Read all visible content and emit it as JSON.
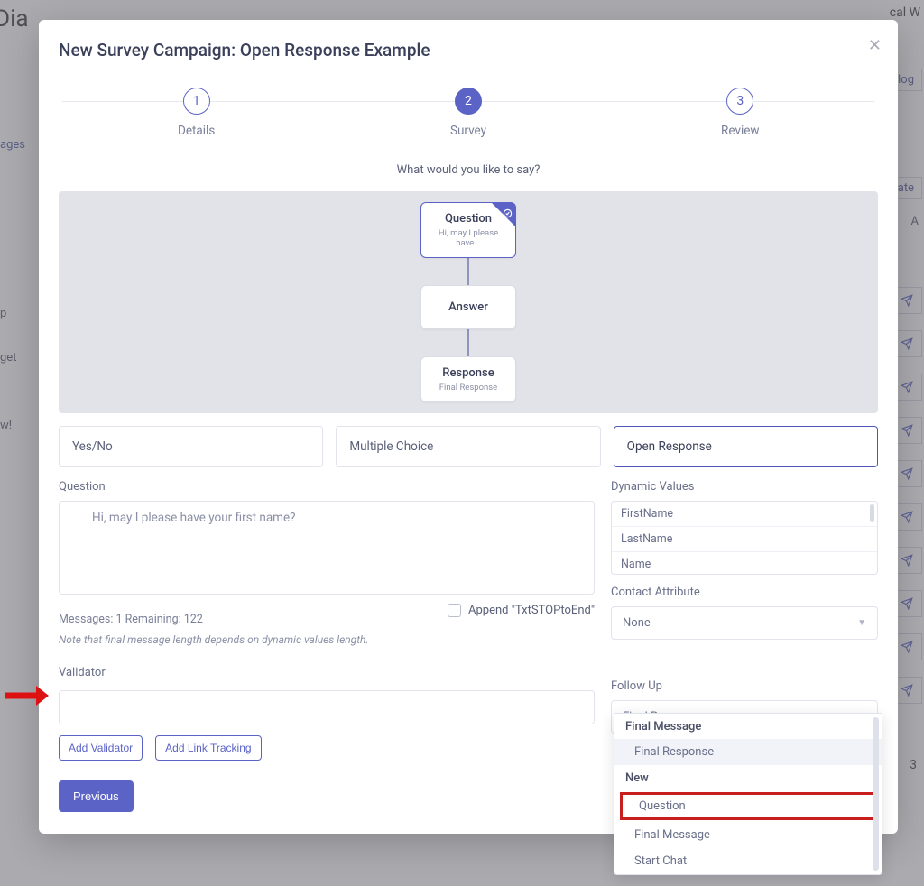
{
  "background": {
    "title_fragment": "Dia",
    "right_fragment": "cal W",
    "tab": "Dialog",
    "ages": "ages",
    "create": "Create",
    "ac": "A",
    "side_items": [
      "p",
      "get",
      "w!"
    ],
    "page_num": "3"
  },
  "modal": {
    "title": "New Survey Campaign: Open Response Example",
    "steps": [
      {
        "num": "1",
        "label": "Details"
      },
      {
        "num": "2",
        "label": "Survey"
      },
      {
        "num": "3",
        "label": "Review"
      }
    ],
    "prompt": "What would you like to say?",
    "diagram": {
      "question": {
        "title": "Question",
        "sub": "Hi, may I please have..."
      },
      "answer": {
        "title": "Answer"
      },
      "response": {
        "title": "Response",
        "sub": "Final Response"
      }
    },
    "question_types": {
      "yesno": "Yes/No",
      "multiple": "Multiple Choice",
      "open": "Open Response"
    },
    "question_label": "Question",
    "question_value": "Hi, may I please have your first name?",
    "messages_meta": "Messages: 1 Remaining: 122",
    "messages_note": "Note that final message length depends on dynamic values length.",
    "append_label": "Append \"TxtSTOPtoEnd\"",
    "dynamic_label": "Dynamic Values",
    "dynamic_values": [
      "FirstName",
      "LastName",
      "Name"
    ],
    "contact_attr_label": "Contact Attribute",
    "contact_attr_value": "None",
    "validator_label": "Validator",
    "btn_add_validator": "Add Validator",
    "btn_add_link": "Add Link Tracking",
    "btn_previous": "Previous",
    "followup_label": "Follow Up",
    "followup_value": "Final Response"
  },
  "dropdown": {
    "group1_label": "Final Message",
    "group1_items": [
      "Final Response"
    ],
    "group2_label": "New",
    "group2_items": [
      "Question",
      "Final Message",
      "Start Chat"
    ]
  }
}
